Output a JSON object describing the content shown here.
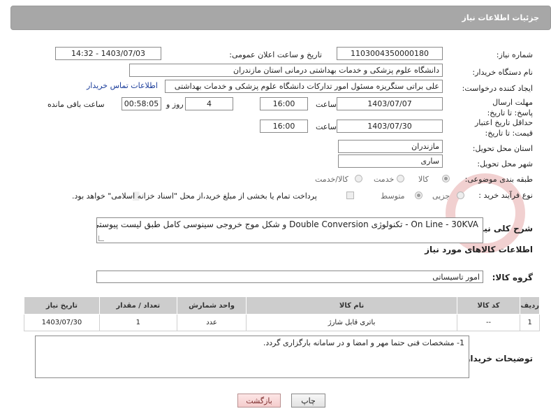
{
  "header": {
    "title": "جزئیات اطلاعات نیاز"
  },
  "need_number": {
    "label": "شماره نیاز:",
    "value": "1103004350000180"
  },
  "announce": {
    "label": "تاریخ و ساعت اعلان عمومی:",
    "value": "1403/07/03 - 14:32"
  },
  "buyer_org": {
    "label": "نام دستگاه خریدار:",
    "value": "دانشگاه علوم پزشکی و خدمات بهداشتی  درمانی استان مازندران"
  },
  "requester": {
    "label": "ایجاد کننده درخواست:",
    "value": "علی براتی ستگریزه مسئول امور تدارکات دانشگاه علوم پزشکی و خدمات بهداشتی",
    "contact_link": "اطلاعات تماس خریدار"
  },
  "deadline": {
    "label": "مهلت ارسال پاسخ: تا تاریخ:",
    "date": "1403/07/07",
    "time_label": "ساعت",
    "time": "16:00",
    "days": "4",
    "days_label": "روز و",
    "remaining": "00:58:05",
    "remaining_label": "ساعت باقی مانده"
  },
  "price_validity": {
    "label": "حداقل تاریخ اعتبار قیمت: تا تاریخ:",
    "date": "1403/07/30",
    "time_label": "ساعت",
    "time": "16:00"
  },
  "province": {
    "label": "استان محل تحویل:",
    "value": "مازندران"
  },
  "city": {
    "label": "شهر محل تحویل:",
    "value": "ساری"
  },
  "category": {
    "label": "طبقه بندی موضوعی:",
    "options": [
      "کالا",
      "خدمت",
      "کالا/خدمت"
    ],
    "selected": "کالا"
  },
  "purchase_type": {
    "label": "نوع فرآیند خرید :",
    "options": [
      "جزیی",
      "متوسط"
    ],
    "selected": "متوسط",
    "note": "پرداخت تمام یا بخشی از مبلغ خرید،از محل \"اسناد خزانه اسلامی\" خواهد بود."
  },
  "description": {
    "label": "شرح کلی نیاز:",
    "value": "On Line  - 30KVA - تکنولوژی Double Conversion و شکل موج خروجی سینوسی کامل طبق لیست پیوستی."
  },
  "goods_section": {
    "title": "اطلاعات کالاهای مورد نیاز"
  },
  "goods_group": {
    "label": "گروه کالا:",
    "value": "امور تاسیساتی"
  },
  "table": {
    "headers": [
      "ردیف",
      "کد کالا",
      "نام کالا",
      "واحد شمارش",
      "تعداد / مقدار",
      "تاریخ نیاز"
    ],
    "rows": [
      [
        "1",
        "--",
        "باتری قابل شارژ",
        "عدد",
        "1",
        "1403/07/30"
      ]
    ]
  },
  "buyer_notes": {
    "label": "توضیحات خریدار:",
    "value": "1- مشخصات فنی حتما مهر و امضا و در سامانه بارگزاری گردد."
  },
  "buttons": {
    "print": "چاپ",
    "back": "بازگشت"
  },
  "watermark_text": "AriaTender.neT"
}
